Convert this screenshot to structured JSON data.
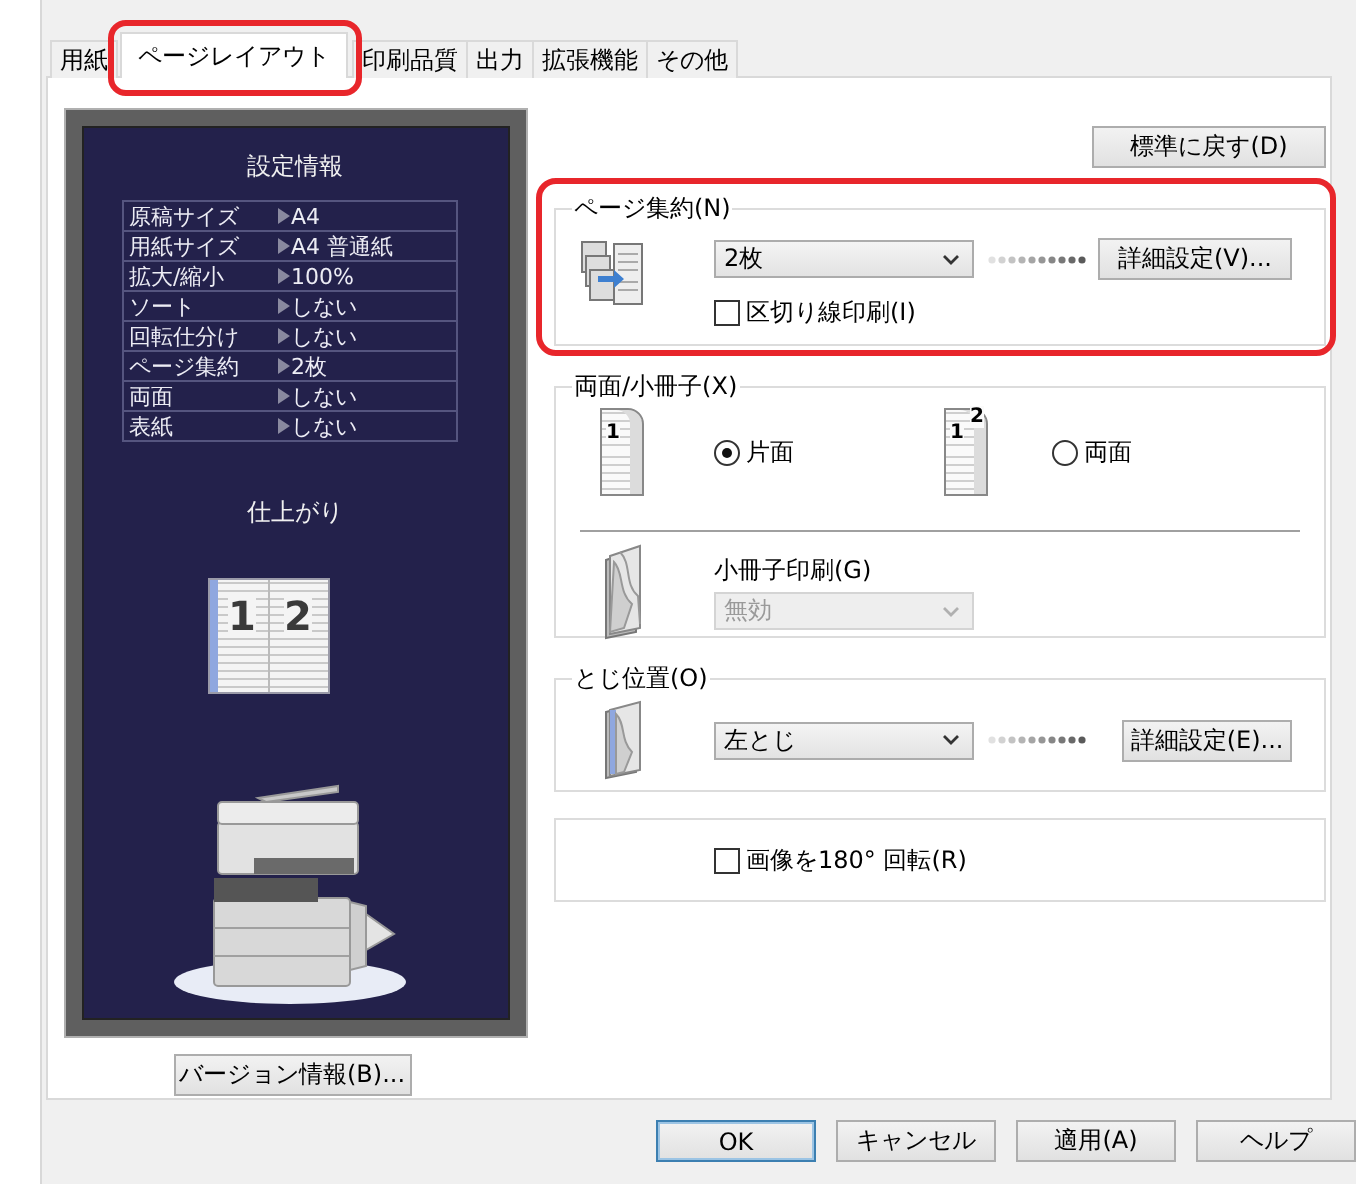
{
  "tabs": [
    {
      "label": "用紙",
      "selected": false,
      "highlighted": false
    },
    {
      "label": "ページレイアウト",
      "selected": true,
      "highlighted": true
    },
    {
      "label": "印刷品質",
      "selected": false,
      "highlighted": false
    },
    {
      "label": "出力",
      "selected": false,
      "highlighted": false
    },
    {
      "label": "拡張機能",
      "selected": false,
      "highlighted": false
    },
    {
      "label": "その他",
      "selected": false,
      "highlighted": false
    }
  ],
  "preview": {
    "title": "設定情報",
    "settings": [
      {
        "name": "原稿サイズ",
        "value": "A4"
      },
      {
        "name": "用紙サイズ",
        "value": "A4 普通紙"
      },
      {
        "name": "拡大/縮小",
        "value": "100%"
      },
      {
        "name": "ソート",
        "value": "しない"
      },
      {
        "name": "回転仕分け",
        "value": "しない"
      },
      {
        "name": "ページ集約",
        "value": "2枚"
      },
      {
        "name": "両面",
        "value": "しない"
      },
      {
        "name": "表紙",
        "value": "しない"
      }
    ],
    "finish_label": "仕上がり",
    "finish_pages": [
      "1",
      "2"
    ]
  },
  "version_button": "バージョン情報(B)...",
  "reset_button": "標準に戻す(D)",
  "page_aggregate": {
    "legend": "ページ集約(N)",
    "highlighted": true,
    "select": {
      "value": "2枚",
      "disabled": false
    },
    "detail_button": "詳細設定(V)...",
    "divider_checkbox": {
      "label": "区切り線印刷(I)",
      "checked": false
    }
  },
  "duplex": {
    "legend": "両面/小冊子(X)",
    "options": [
      {
        "label": "片面",
        "selected": true,
        "page_labels": [
          "1"
        ]
      },
      {
        "label": "両面",
        "selected": false,
        "page_labels": [
          "1",
          "2"
        ]
      }
    ],
    "booklet": {
      "label": "小冊子印刷(G)",
      "select": {
        "value": "無効",
        "disabled": true
      }
    }
  },
  "binding": {
    "legend": "とじ位置(O)",
    "select": {
      "value": "左とじ",
      "disabled": false
    },
    "detail_button": "詳細設定(E)..."
  },
  "rotate": {
    "label": "画像を180° 回転(R)",
    "checked": false
  },
  "footer_buttons": [
    {
      "label": "OK",
      "kind": "default"
    },
    {
      "label": "キャンセル",
      "kind": "normal"
    },
    {
      "label": "適用(A)",
      "kind": "normal"
    },
    {
      "label": "ヘルプ",
      "kind": "normal"
    }
  ]
}
